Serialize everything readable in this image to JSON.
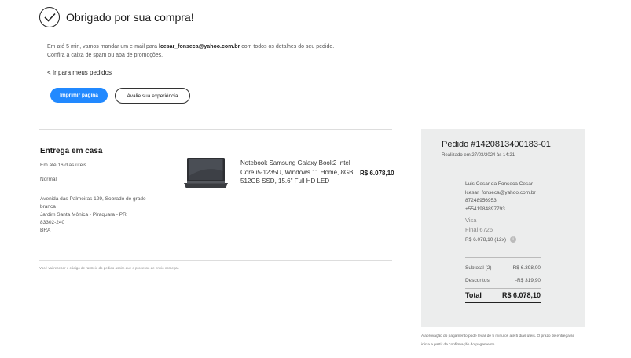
{
  "header": {
    "title": "Obrigado por sua compra!",
    "message_part1": "Em até 5 min, vamos mandar um e-mail para ",
    "email": "lcesar_fonseca@yahoo.com.br",
    "message_part2": " com todos os detalhes do seu pedido.",
    "message_line2": "Confira a caixa de spam ou aba de promoções.",
    "back_link": "< Ir para meus pedidos",
    "print_button": "Imprimir página",
    "review_button": "Avalie sua experiência"
  },
  "delivery": {
    "title": "Entrega em casa",
    "eta": "Em até 16 dias úteis",
    "type": "Normal",
    "address_line1": "Avenida das Palmeiras 129, Sobrado de grade",
    "address_line2": "branca",
    "address_line3": "Jardim Santa Mônica - Piraquara - PR",
    "zip": "83302-240",
    "country": "BRA",
    "tracking_note": "Você vai receber o código de rastreio do pedido assim que o processo de envio começar."
  },
  "product": {
    "name_line1": "Notebook Samsung Galaxy Book2 Intel",
    "name_line2": "Core i5-1235U, Windows 11 Home, 8GB,",
    "name_line3": "512GB SSD, 15.6\" Full HD LED",
    "price": "R$ 6.078,10",
    "image_icon": "laptop-image"
  },
  "order": {
    "title": "Pedido #1420813400183-01",
    "date": "Realizado em 27/03/2024 às 14:21",
    "customer_name": "Luis Cesar da Fonseca Cesar",
    "customer_email": "lcesar_fonseca@yahoo.com.br",
    "phone1": "87248956953",
    "phone2": "+5541984897793",
    "payment_method": "Visa",
    "card_final": "Final 6726",
    "installments": "R$ 6.078,10 (12x)",
    "info_icon": "info-icon",
    "subtotal_label": "Subtotal (2)",
    "subtotal_value": "R$ 6.398,00",
    "discount_label": "Descontos",
    "discount_value": "-R$ 319,90",
    "total_label": "Total",
    "total_value": "R$ 6.078,10"
  },
  "approval_note": "A aprovação do pagamento pode levar de 5 minutos até 5 dias úteis. O prazo de entrega se inicia a partir da confirmação do pagamento.",
  "colors": {
    "accent": "#2189ff",
    "panel_bg": "#eceded"
  }
}
